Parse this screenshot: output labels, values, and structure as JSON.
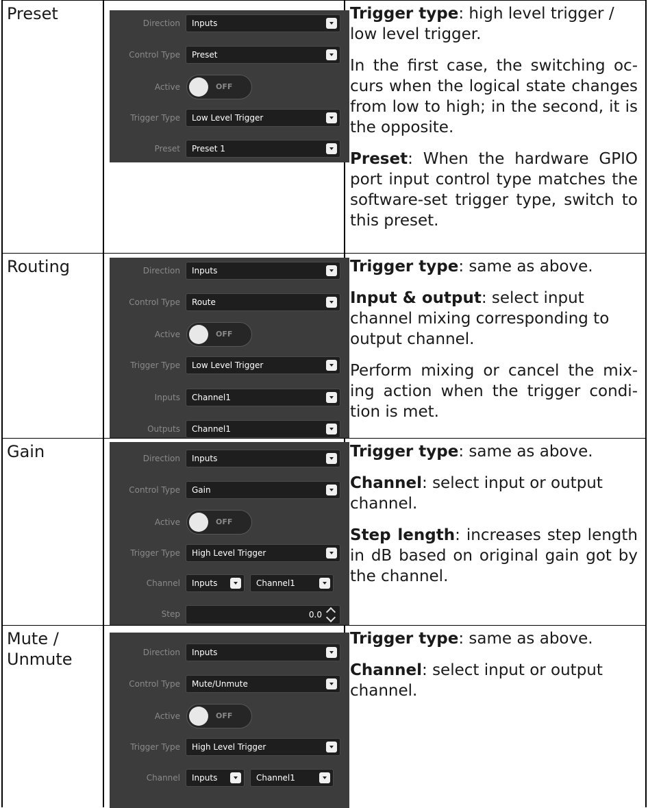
{
  "rows": [
    {
      "label": "Preset",
      "panel": {
        "direction_label": "Direction",
        "direction_value": "Inputs",
        "control_type_label": "Control Type",
        "control_type_value": "Preset",
        "active_label": "Active",
        "active_state": "OFF",
        "trigger_type_label": "Trigger Type",
        "trigger_type_value": "Low Level Trigger",
        "preset_label": "Preset",
        "preset_value": "Preset 1"
      },
      "desc": {
        "p1_bold": "Trigger  type",
        "p1_text": ": high level trigger / low level trigger.",
        "p2_text": "In the first case, the switching oc-curs when the logical state changes from low to high; in the second, it is the opposite.",
        "p3_bold": "Preset",
        "p3_text": ": When the hardware GPIO port input control type matches the software-set trigger type, switch to this preset."
      }
    },
    {
      "label": "Routing",
      "panel": {
        "direction_label": "Direction",
        "direction_value": "Inputs",
        "control_type_label": "Control Type",
        "control_type_value": "Route",
        "active_label": "Active",
        "active_state": "OFF",
        "trigger_type_label": "Trigger Type",
        "trigger_type_value": "Low Level Trigger",
        "inputs_label": "Inputs",
        "inputs_value": "Channel1",
        "outputs_label": "Outputs",
        "outputs_value": "Channel1"
      },
      "desc": {
        "p1_bold": "Trigger type",
        "p1_text": ": same as above.",
        "p2_bold": "Input & output",
        "p2_text": ": select input channel mixing corresponding to output channel.",
        "p3_text": "Perform mixing or cancel the mix-ing action when the trigger condi-tion is met."
      }
    },
    {
      "label": "Gain",
      "panel": {
        "direction_label": "Direction",
        "direction_value": "Inputs",
        "control_type_label": "Control Type",
        "control_type_value": "Gain",
        "active_label": "Active",
        "active_state": "OFF",
        "trigger_type_label": "Trigger Type",
        "trigger_type_value": "High Level Trigger",
        "channel_label": "Channel",
        "channel_dir_value": "Inputs",
        "channel_value": "Channel1",
        "step_label": "Step",
        "step_value": "0.0"
      },
      "desc": {
        "p1_bold": "Trigger type",
        "p1_text": ": same as above.",
        "p2_bold": "Channel",
        "p2_text": ": select input or output channel.",
        "p3_bold": "Step length",
        "p3_text": ": increases step length in dB based on original gain got by the channel."
      }
    },
    {
      "label": "Mute / Unmute",
      "panel": {
        "direction_label": "Direction",
        "direction_value": "Inputs",
        "control_type_label": "Control Type",
        "control_type_value": "Mute/Unmute",
        "active_label": "Active",
        "active_state": "OFF",
        "trigger_type_label": "Trigger Type",
        "trigger_type_value": "High Level Trigger",
        "channel_label": "Channel",
        "channel_dir_value": "Inputs",
        "channel_value": "Channel1"
      },
      "desc": {
        "p1_bold": "Trigger type",
        "p1_text": ": same as above.",
        "p2_bold": "Channel",
        "p2_text": ": select input or output channel."
      }
    }
  ]
}
